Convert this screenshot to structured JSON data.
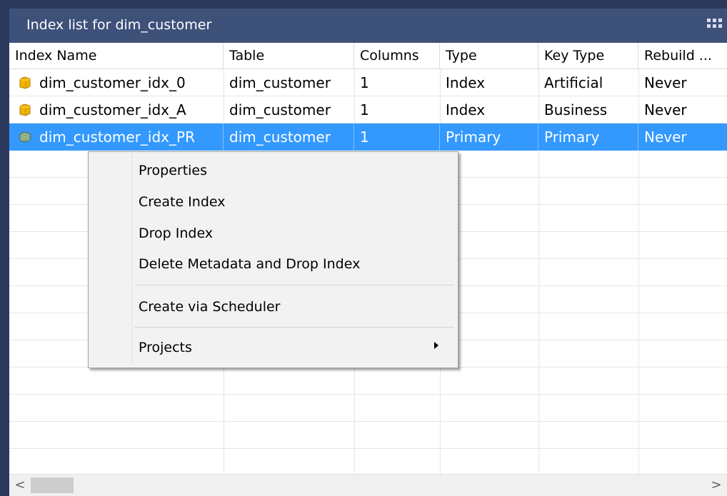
{
  "window": {
    "title": "Index list for dim_customer"
  },
  "columns": [
    "Index Name",
    "Table",
    "Columns",
    "Type",
    "Key Type",
    "Rebuild ..."
  ],
  "rows": [
    {
      "name": "dim_customer_idx_0",
      "table": "dim_customer",
      "columns": "1",
      "type": "Index",
      "key_type": "Artificial",
      "rebuild": "Never",
      "icon": "index-icon-yellow"
    },
    {
      "name": "dim_customer_idx_A",
      "table": "dim_customer",
      "columns": "1",
      "type": "Index",
      "key_type": "Business",
      "rebuild": "Never",
      "icon": "index-icon-yellow"
    },
    {
      "name": "dim_customer_idx_PR",
      "table": "dim_customer",
      "columns": "1",
      "type": "Primary",
      "key_type": "Primary",
      "rebuild": "Never",
      "icon": "primary-key-icon-green",
      "selected": true
    }
  ],
  "context_menu": {
    "items": [
      "Properties",
      "Create Index",
      "Drop Index",
      "Delete Metadata and Drop Index",
      "Create via Scheduler",
      "Projects"
    ]
  },
  "scrollbar": {
    "left_arrow": "<",
    "right_arrow": ">"
  },
  "colors": {
    "title_bar": "#3e5179",
    "selection": "#3399ff",
    "index_icon": "#f0b400",
    "primary_icon": "#7fa07a"
  }
}
